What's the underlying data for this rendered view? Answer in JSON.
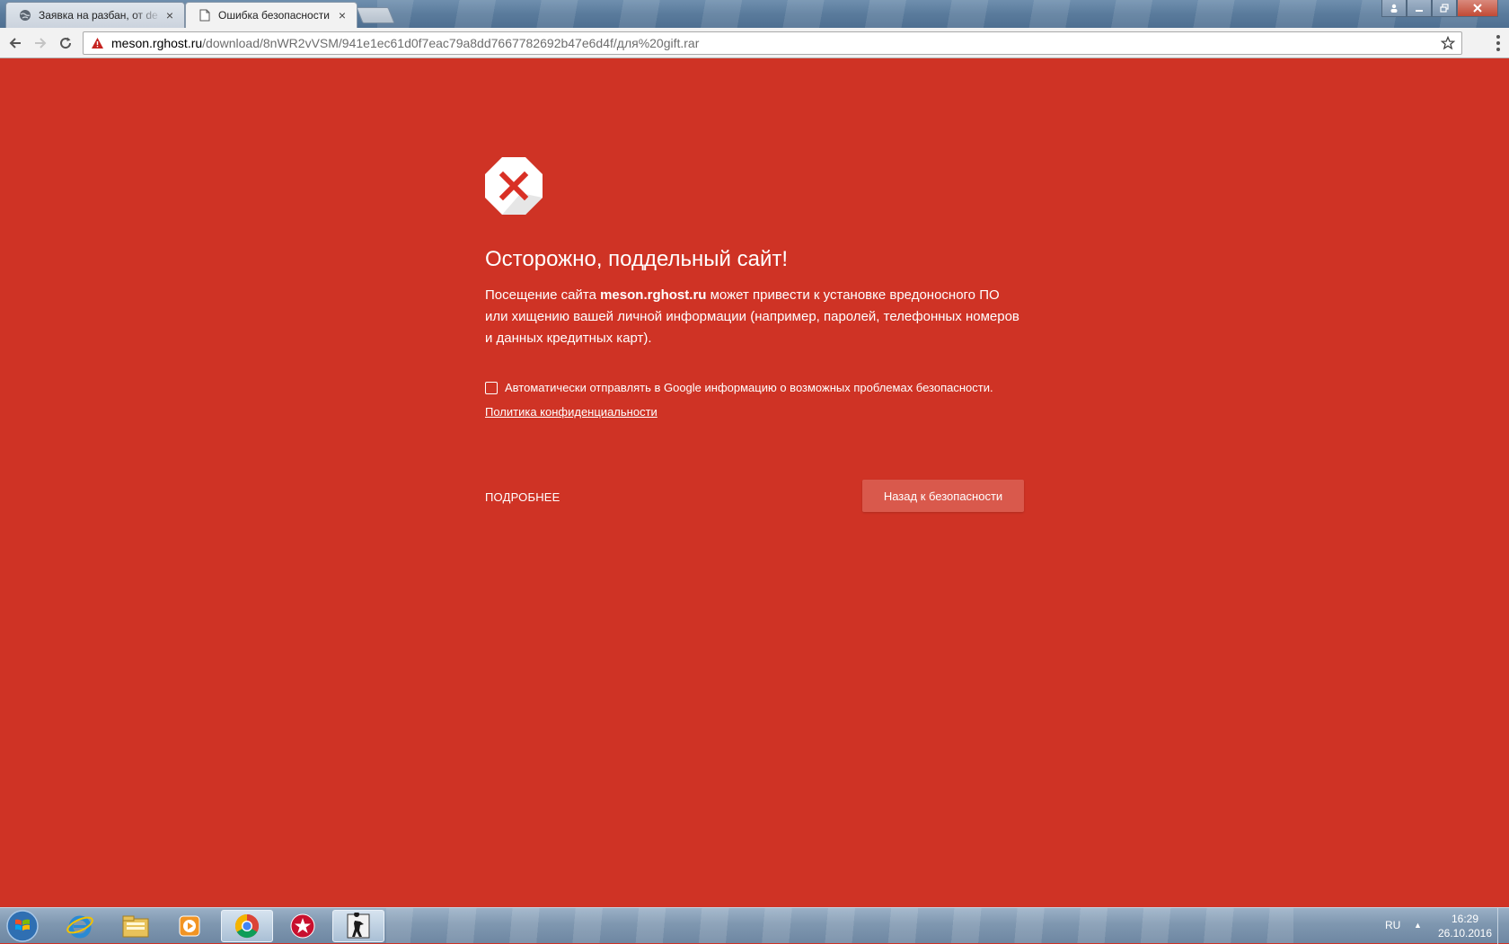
{
  "browser": {
    "tabs": [
      {
        "title": "Заявка на разбан, от de",
        "active": false,
        "favicon": "site-globe-icon"
      },
      {
        "title": "Ошибка безопасности",
        "active": true,
        "favicon": "page-icon"
      }
    ],
    "tab_close_glyph": "×",
    "address": {
      "host": "meson.rghost.ru",
      "path": "/download/8nWR2vVSM/941e1ec61d0f7eac79a8dd7667782692b47e6d4f/для%20gift.rar"
    }
  },
  "interstitial": {
    "heading": "Осторожно, поддельный сайт!",
    "desc_before": "Посещение сайта ",
    "desc_host": "meson.rghost.ru",
    "desc_after": " может привести к установке вредоносного ПО или хищению вашей личной информации (например, паролей, телефонных номеров и данных кредитных карт).",
    "checkbox_label": "Автоматически отправлять в Google информацию о возможных проблемах безопасности.",
    "checkbox_checked": false,
    "policy_link": "Политика конфиденциальности",
    "details_button": "ПОДРОБНЕЕ",
    "back_button": "Назад к безопасности",
    "background_color": "#cf3325"
  },
  "taskbar": {
    "pinned": [
      "internet-explorer-icon",
      "file-explorer-icon",
      "media-player-icon",
      "chrome-icon",
      "pokerstars-icon",
      "counter-strike-icon"
    ],
    "language": "RU",
    "time": "16:29",
    "date": "26.10.2016"
  }
}
